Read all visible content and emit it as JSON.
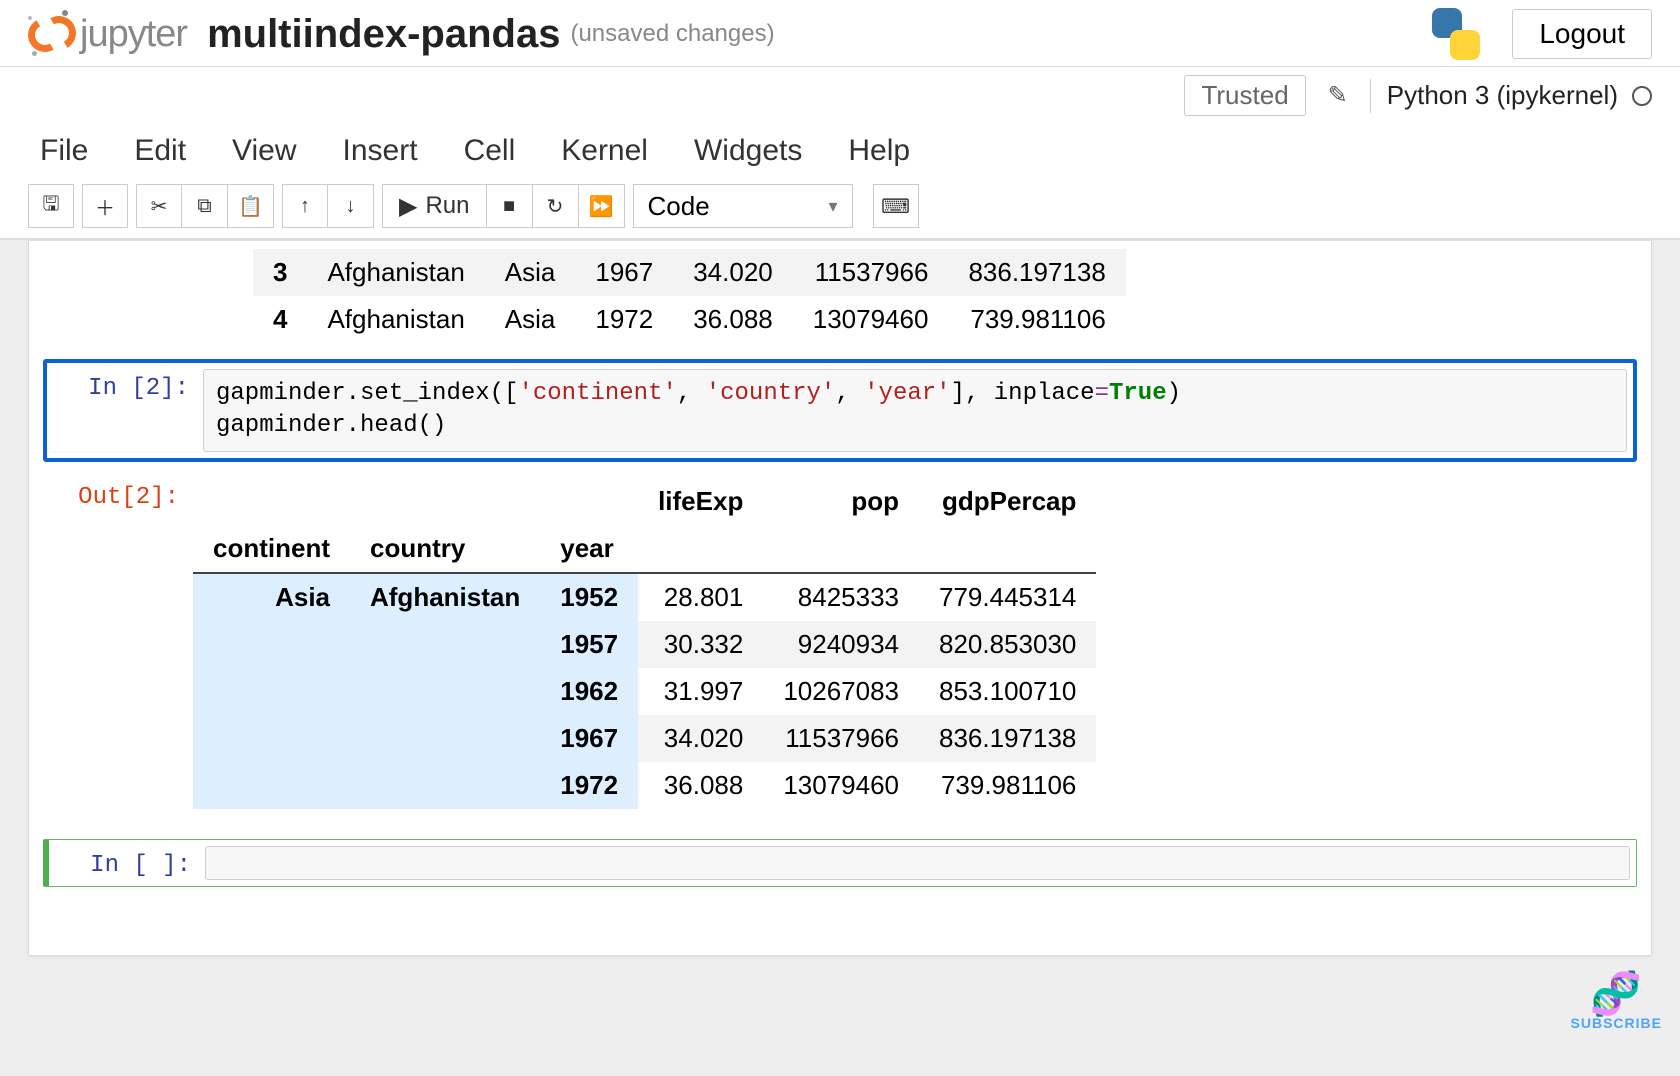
{
  "header": {
    "logo_word": "jupyter",
    "notebook_title": "multiindex-pandas",
    "unsaved": "(unsaved changes)",
    "logout": "Logout"
  },
  "kernel_row": {
    "trusted": "Trusted",
    "kernel_name": "Python 3 (ipykernel)"
  },
  "menu": {
    "file": "File",
    "edit": "Edit",
    "view": "View",
    "insert": "Insert",
    "cell": "Cell",
    "kernel": "Kernel",
    "widgets": "Widgets",
    "help": "Help"
  },
  "toolbar": {
    "run_label": "Run",
    "cell_type": "Code"
  },
  "cells": {
    "top_output_rows": [
      {
        "idx": "3",
        "country": "Afghanistan",
        "continent": "Asia",
        "year": "1967",
        "lifeExp": "34.020",
        "pop": "11537966",
        "gdp": "836.197138"
      },
      {
        "idx": "4",
        "country": "Afghanistan",
        "continent": "Asia",
        "year": "1972",
        "lifeExp": "36.088",
        "pop": "13079460",
        "gdp": "739.981106"
      }
    ],
    "in2_prompt": "In [2]:",
    "out2_prompt": "Out[2]:",
    "in2_code_plain": "gapminder.set_index(['continent', 'country', 'year'], inplace=True)\ngapminder.head()",
    "out2": {
      "value_headers": {
        "lifeExp": "lifeExp",
        "pop": "pop",
        "gdp": "gdpPercap"
      },
      "index_headers": {
        "continent": "continent",
        "country": "country",
        "year": "year"
      },
      "rows": [
        {
          "continent": "Asia",
          "country": "Afghanistan",
          "year": "1952",
          "lifeExp": "28.801",
          "pop": "8425333",
          "gdp": "779.445314"
        },
        {
          "continent": "",
          "country": "",
          "year": "1957",
          "lifeExp": "30.332",
          "pop": "9240934",
          "gdp": "820.853030"
        },
        {
          "continent": "",
          "country": "",
          "year": "1962",
          "lifeExp": "31.997",
          "pop": "10267083",
          "gdp": "853.100710"
        },
        {
          "continent": "",
          "country": "",
          "year": "1967",
          "lifeExp": "34.020",
          "pop": "11537966",
          "gdp": "836.197138"
        },
        {
          "continent": "",
          "country": "",
          "year": "1972",
          "lifeExp": "36.088",
          "pop": "13079460",
          "gdp": "739.981106"
        }
      ]
    },
    "empty_prompt": "In [ ]:"
  },
  "subscribe": "SUBSCRIBE"
}
